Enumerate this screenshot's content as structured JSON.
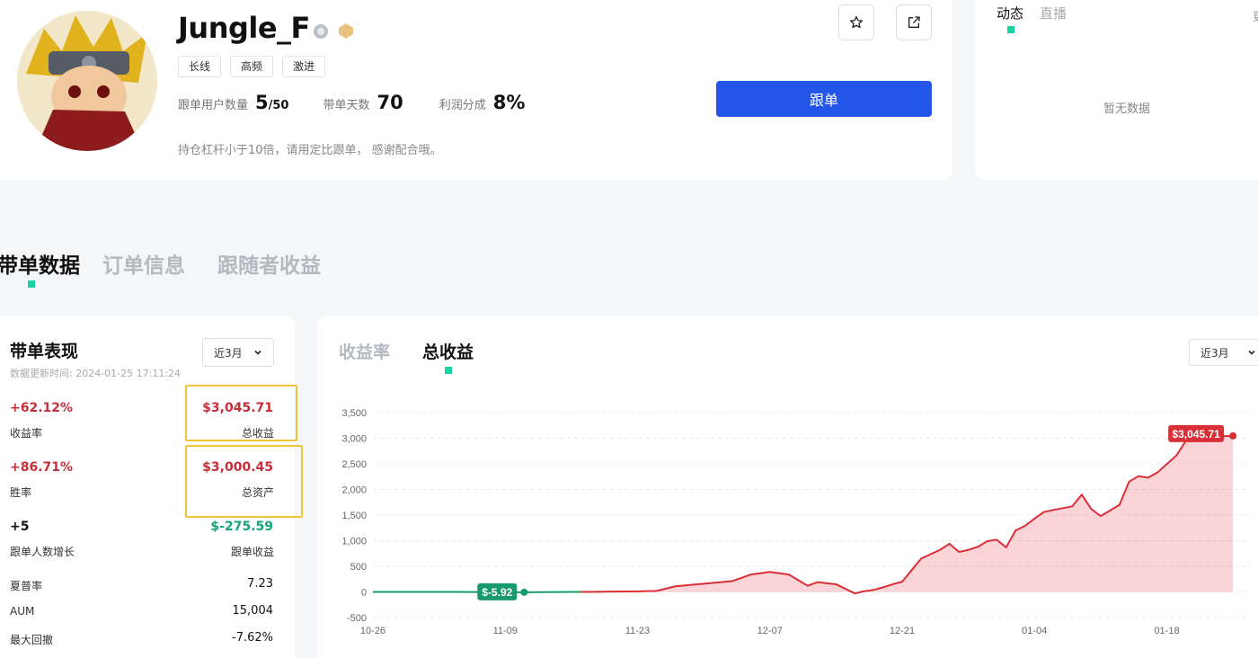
{
  "profile": {
    "username": "Jungle_F",
    "tags": [
      "长线",
      "高频",
      "激进"
    ],
    "stats": {
      "followers_label": "跟单用户数量",
      "followers_value": "5",
      "followers_max": "/50",
      "days_label": "带单天数",
      "days_value": "70",
      "share_label": "利润分成",
      "share_value": "8%"
    },
    "description": "持仓杠杆小于10倍，请用定比跟单， 感谢配合哦。",
    "follow_button": "跟单"
  },
  "feed": {
    "tabs": [
      "动态",
      "直播"
    ],
    "more": "更多",
    "empty": "暂无数据"
  },
  "main_tabs": [
    "带单数据",
    "订单信息",
    "跟随者收益"
  ],
  "performance": {
    "title": "带单表现",
    "updated": "数据更新时间: 2024-01-25 17:11:24",
    "range": "近3月",
    "rows": [
      {
        "left_value": "+62.12%",
        "left_label": "收益率",
        "right_value": "$3,045.71",
        "right_label": "总收益"
      },
      {
        "left_value": "+86.71%",
        "left_label": "胜率",
        "right_value": "$3,000.45",
        "right_label": "总资产"
      },
      {
        "left_value": "+5",
        "left_label": "跟单人数增长",
        "right_value": "$-275.59",
        "right_label": "跟单收益"
      }
    ],
    "metrics": [
      {
        "label": "夏普率",
        "value": "7.23"
      },
      {
        "label": "AUM",
        "value": "15,004"
      },
      {
        "label": "最大回撤",
        "value": "-7.62%"
      }
    ]
  },
  "chart_panel": {
    "tabs": [
      "收益率",
      "总收益"
    ],
    "range": "近3月"
  },
  "colors": {
    "accent": "#2255e8",
    "indicator": "#19d3a2",
    "profit": "#c62f3a",
    "loss": "#11a37b",
    "highlight": "#f3c13a"
  },
  "chart_data": {
    "type": "area",
    "title": "",
    "xlabel": "",
    "ylabel": "",
    "ylim": [
      -500,
      3500
    ],
    "yticks": [
      "3,500",
      "3,000",
      "2,500",
      "2,000",
      "1,500",
      "1,000",
      "500",
      "0",
      "-500"
    ],
    "xticks": [
      "10-26",
      "11-09",
      "11-23",
      "12-07",
      "12-21",
      "01-04",
      "01-18"
    ],
    "grid": true,
    "annotations": [
      {
        "label": "$-5.92",
        "x": "11-11",
        "y": -5.92
      },
      {
        "label": "$3,045.71",
        "x": "01-25",
        "y": 3045.71
      }
    ],
    "series": [
      {
        "x": [
          "10-26",
          "11-04",
          "11-11",
          "11-17",
          "11-23",
          "11-25",
          "11-27",
          "11-30",
          "12-03",
          "12-05",
          "12-07",
          "12-09",
          "12-11",
          "12-12",
          "12-14",
          "12-16",
          "12-17",
          "12-18",
          "12-19",
          "12-20",
          "12-21",
          "12-23",
          "12-25",
          "12-26",
          "12-27",
          "12-28",
          "12-29",
          "12-30",
          "12-31",
          "01-01",
          "01-02",
          "01-03",
          "01-04",
          "01-05",
          "01-06",
          "01-08",
          "01-09",
          "01-10",
          "01-11",
          "01-12",
          "01-13",
          "01-14",
          "01-15",
          "01-16",
          "01-17",
          "01-19",
          "01-20",
          "01-22",
          "01-23",
          "01-24",
          "01-25"
        ],
        "values": [
          0,
          0,
          -6,
          0,
          10,
          20,
          110,
          160,
          210,
          340,
          390,
          340,
          120,
          190,
          150,
          -30,
          15,
          40,
          90,
          150,
          200,
          650,
          820,
          940,
          780,
          820,
          880,
          990,
          1020,
          870,
          1200,
          1290,
          1430,
          1560,
          1600,
          1670,
          1900,
          1620,
          1480,
          1590,
          1700,
          2150,
          2260,
          2230,
          2330,
          2660,
          2940,
          2950,
          3020,
          3040,
          3045.71
        ]
      }
    ]
  }
}
